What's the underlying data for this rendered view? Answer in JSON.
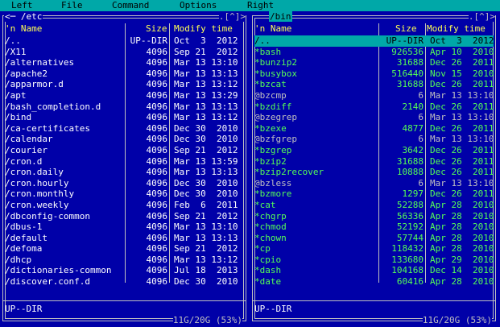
{
  "menubar": {
    "items": [
      "Left",
      "File",
      "Command",
      "Options",
      "Right"
    ]
  },
  "left_panel": {
    "path": "<─ /etc",
    "brackets": ".[^]>",
    "columns": {
      "name": "'n           Name",
      "size": "Size",
      "time": "Modify time"
    },
    "rows": [
      {
        "name": "/..",
        "size": "UP--DIR",
        "time": "Oct  3  2012",
        "style": "normal"
      },
      {
        "name": "/X11",
        "size": "4096",
        "time": "Sep 21  2012",
        "style": "normal"
      },
      {
        "name": "/alternatives",
        "size": "4096",
        "time": "Mar 13 13:10",
        "style": "normal"
      },
      {
        "name": "/apache2",
        "size": "4096",
        "time": "Mar 13 13:13",
        "style": "normal"
      },
      {
        "name": "/apparmor.d",
        "size": "4096",
        "time": "Mar 13 13:12",
        "style": "normal"
      },
      {
        "name": "/apt",
        "size": "4096",
        "time": "Mar 13 13:29",
        "style": "normal"
      },
      {
        "name": "/bash_completion.d",
        "size": "4096",
        "time": "Mar 13 13:13",
        "style": "normal"
      },
      {
        "name": "/bind",
        "size": "4096",
        "time": "Mar 13 13:12",
        "style": "normal"
      },
      {
        "name": "/ca-certificates",
        "size": "4096",
        "time": "Dec 30  2010",
        "style": "normal"
      },
      {
        "name": "/calendar",
        "size": "4096",
        "time": "Dec 30  2010",
        "style": "normal"
      },
      {
        "name": "/courier",
        "size": "4096",
        "time": "Sep 21  2012",
        "style": "normal"
      },
      {
        "name": "/cron.d",
        "size": "4096",
        "time": "Mar 13 13:59",
        "style": "normal"
      },
      {
        "name": "/cron.daily",
        "size": "4096",
        "time": "Mar 13 13:13",
        "style": "normal"
      },
      {
        "name": "/cron.hourly",
        "size": "4096",
        "time": "Dec 30  2010",
        "style": "normal"
      },
      {
        "name": "/cron.monthly",
        "size": "4096",
        "time": "Dec 30  2010",
        "style": "normal"
      },
      {
        "name": "/cron.weekly",
        "size": "4096",
        "time": "Feb  6  2011",
        "style": "normal"
      },
      {
        "name": "/dbconfig-common",
        "size": "4096",
        "time": "Sep 21  2012",
        "style": "normal"
      },
      {
        "name": "/dbus-1",
        "size": "4096",
        "time": "Mar 13 13:10",
        "style": "normal"
      },
      {
        "name": "/default",
        "size": "4096",
        "time": "Mar 13 13:13",
        "style": "normal"
      },
      {
        "name": "/defoma",
        "size": "4096",
        "time": "Sep 21  2012",
        "style": "normal"
      },
      {
        "name": "/dhcp",
        "size": "4096",
        "time": "Mar 13 13:12",
        "style": "normal"
      },
      {
        "name": "/dictionaries-common",
        "size": "4096",
        "time": "Jul 18  2013",
        "style": "normal"
      },
      {
        "name": "/discover.conf.d",
        "size": "4096",
        "time": "Dec 30  2010",
        "style": "normal"
      }
    ],
    "status": "UP--DIR",
    "free": "11G/20G (53%)"
  },
  "right_panel": {
    "path": "/bin",
    "brackets": ".[^]>",
    "columns": {
      "name": "'n           Name",
      "size": "Size",
      "time": "Modify time"
    },
    "rows": [
      {
        "name": "/..",
        "size": "UP--DIR",
        "time": "Oct  3  2012",
        "style": "selected"
      },
      {
        "name": "*bash",
        "size": "926536",
        "time": "Apr 10  2010",
        "style": "green"
      },
      {
        "name": "*bunzip2",
        "size": "31688",
        "time": "Dec 26  2011",
        "style": "green"
      },
      {
        "name": "*busybox",
        "size": "516440",
        "time": "Nov 15  2010",
        "style": "green"
      },
      {
        "name": "*bzcat",
        "size": "31688",
        "time": "Dec 26  2011",
        "style": "green"
      },
      {
        "name": "@bzcmp",
        "size": "6",
        "time": "Mar 13 13:10",
        "style": "gray"
      },
      {
        "name": "*bzdiff",
        "size": "2140",
        "time": "Dec 26  2011",
        "style": "green"
      },
      {
        "name": "@bzegrep",
        "size": "6",
        "time": "Mar 13 13:10",
        "style": "gray"
      },
      {
        "name": "*bzexe",
        "size": "4877",
        "time": "Dec 26  2011",
        "style": "green"
      },
      {
        "name": "@bzfgrep",
        "size": "6",
        "time": "Mar 13 13:10",
        "style": "gray"
      },
      {
        "name": "*bzgrep",
        "size": "3642",
        "time": "Dec 26  2011",
        "style": "green"
      },
      {
        "name": "*bzip2",
        "size": "31688",
        "time": "Dec 26  2011",
        "style": "green"
      },
      {
        "name": "*bzip2recover",
        "size": "10888",
        "time": "Dec 26  2011",
        "style": "green"
      },
      {
        "name": "@bzless",
        "size": "6",
        "time": "Mar 13 13:10",
        "style": "gray"
      },
      {
        "name": "*bzmore",
        "size": "1297",
        "time": "Dec 26  2011",
        "style": "green"
      },
      {
        "name": "*cat",
        "size": "52288",
        "time": "Apr 28  2010",
        "style": "green"
      },
      {
        "name": "*chgrp",
        "size": "56336",
        "time": "Apr 28  2010",
        "style": "green"
      },
      {
        "name": "*chmod",
        "size": "52192",
        "time": "Apr 28  2010",
        "style": "green"
      },
      {
        "name": "*chown",
        "size": "57744",
        "time": "Apr 28  2010",
        "style": "green"
      },
      {
        "name": "*cp",
        "size": "118432",
        "time": "Apr 28  2010",
        "style": "green"
      },
      {
        "name": "*cpio",
        "size": "133680",
        "time": "Apr 29  2010",
        "style": "green"
      },
      {
        "name": "*dash",
        "size": "104168",
        "time": "Dec 14  2010",
        "style": "green"
      },
      {
        "name": "*date",
        "size": "60416",
        "time": "Apr 28  2010",
        "style": "green"
      }
    ],
    "status": "UP--DIR",
    "free": "11G/20G (53%)"
  }
}
